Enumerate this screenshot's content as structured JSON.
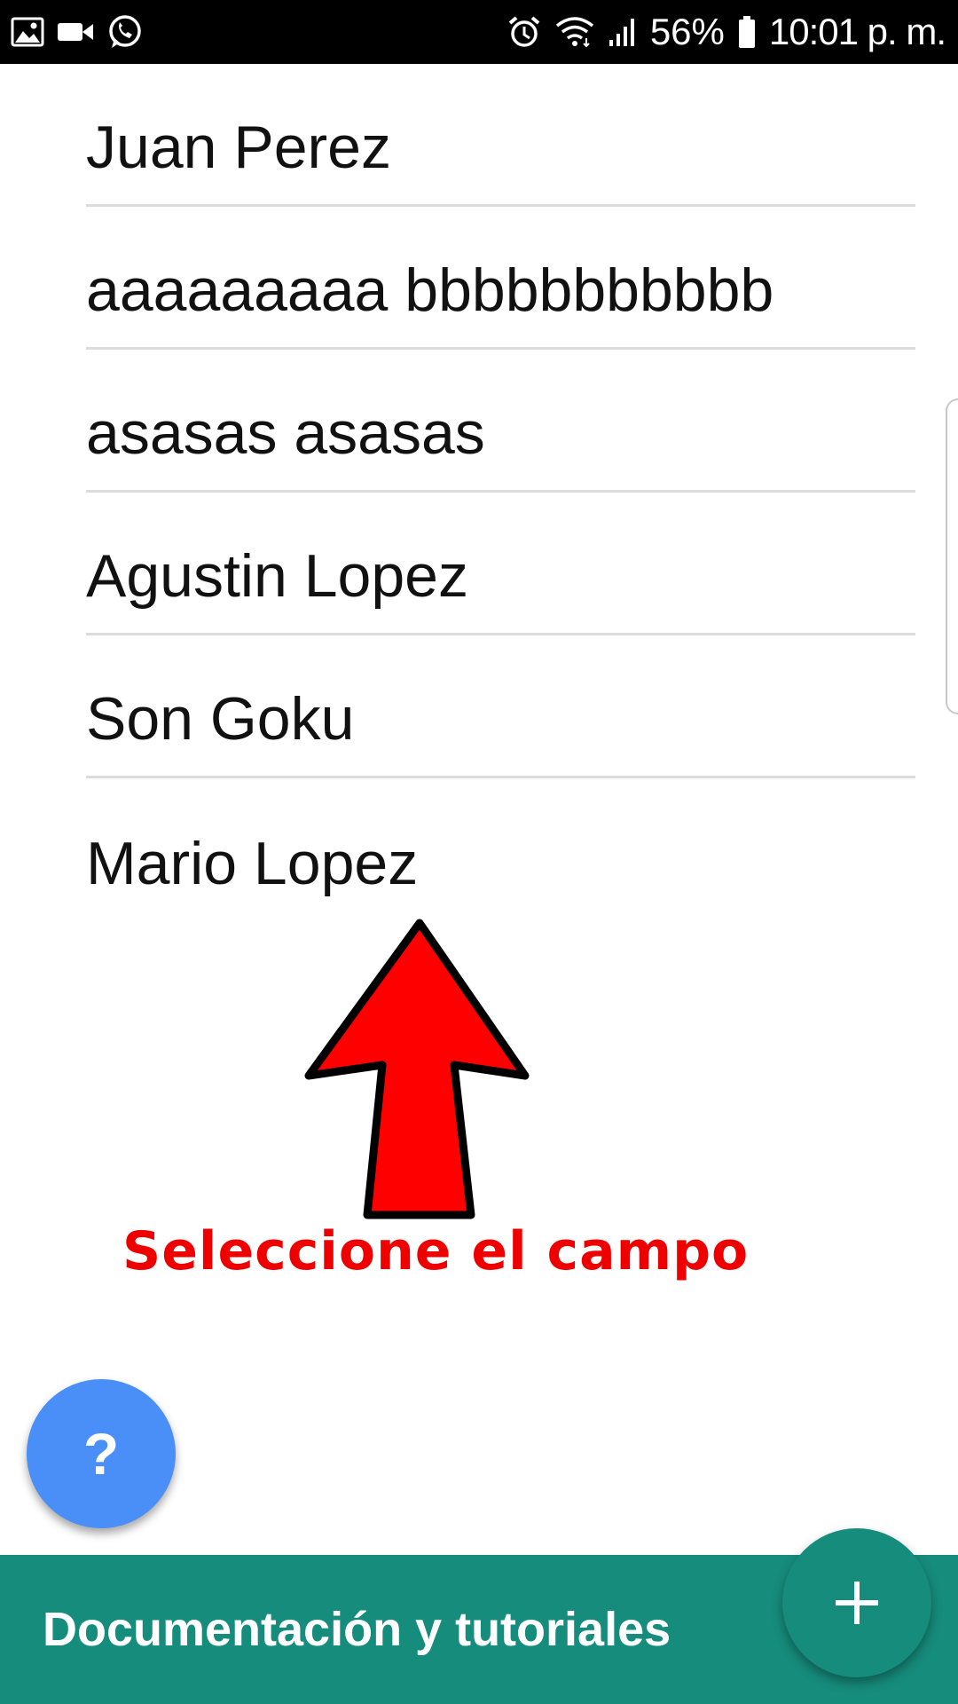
{
  "status_bar": {
    "left_icons": [
      "image-icon",
      "video-camera-icon",
      "whatsapp-icon"
    ],
    "right_icons": [
      "alarm-icon",
      "wifi-icon",
      "signal-icon",
      "battery-icon"
    ],
    "battery": "56%",
    "time": "10:01 p. m."
  },
  "list": {
    "items": [
      {
        "label": "Juan Perez"
      },
      {
        "label": "aaaaaaaaa bbbbbbbbbbb"
      },
      {
        "label": "asasas asasas"
      },
      {
        "label": "Agustin Lopez"
      },
      {
        "label": "Son Goku"
      },
      {
        "label": "Mario Lopez"
      }
    ]
  },
  "annotation": {
    "text": "Seleccione el campo",
    "arrow_color": "#ff0000",
    "text_color": "#ee0000"
  },
  "help_button": {
    "label": "?",
    "color": "#4a8ef7"
  },
  "bottom_bar": {
    "label": "Documentación y tutoriales",
    "color": "#168c7c"
  },
  "add_button": {
    "icon": "plus-icon",
    "color": "#168c7c"
  }
}
